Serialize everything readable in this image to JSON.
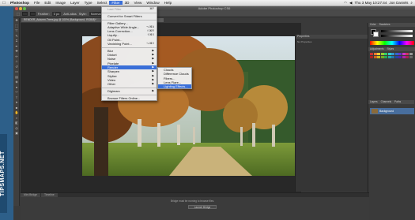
{
  "menubar": {
    "apple": "",
    "items": [
      "Photoshop",
      "File",
      "Edit",
      "Image",
      "Layer",
      "Type",
      "Select",
      "Filter",
      "3D",
      "View",
      "Window",
      "Help"
    ],
    "clock": "Thu 3 May  10:27:44",
    "user": "Jon Daniels"
  },
  "window": {
    "title": "Adobe Photoshop CS6",
    "doc_tab": "RENDER_Autumn-Trees.jpg @ 100% (Background, RGB/8)*"
  },
  "options_bar": {
    "feather_label": "Feather:",
    "feather_value": "0 px",
    "antialias_label": "Anti-alias",
    "style_label": "Style:",
    "style_value": "Normal"
  },
  "filter_menu": {
    "items": [
      {
        "label": "Last Filter",
        "shortcut": "⌘F",
        "disabled": true
      },
      {
        "sep": true
      },
      {
        "label": "Convert for Smart Filters"
      },
      {
        "sep": true
      },
      {
        "label": "Filter Gallery..."
      },
      {
        "label": "Adaptive Wide Angle...",
        "shortcut": "⌥⌘A"
      },
      {
        "label": "Lens Correction...",
        "shortcut": "⇧⌘R"
      },
      {
        "label": "Liquify...",
        "shortcut": "⇧⌘X"
      },
      {
        "label": "Oil Paint..."
      },
      {
        "label": "Vanishing Point...",
        "shortcut": "⌥⌘V"
      },
      {
        "sep": true
      },
      {
        "label": "Blur",
        "submenu": true
      },
      {
        "label": "Distort",
        "submenu": true
      },
      {
        "label": "Noise",
        "submenu": true
      },
      {
        "label": "Pixelate",
        "submenu": true
      },
      {
        "label": "Render",
        "submenu": true,
        "highlighted": true
      },
      {
        "label": "Sharpen",
        "submenu": true
      },
      {
        "label": "Stylize",
        "submenu": true
      },
      {
        "label": "Video",
        "submenu": true
      },
      {
        "label": "Other",
        "submenu": true
      },
      {
        "sep": true
      },
      {
        "label": "Digimarc",
        "submenu": true
      },
      {
        "sep": true
      },
      {
        "label": "Browse Filters Online..."
      }
    ]
  },
  "render_menu": {
    "items": [
      {
        "label": "Clouds"
      },
      {
        "label": "Difference Clouds"
      },
      {
        "label": "Fibers..."
      },
      {
        "label": "Lens Flare..."
      },
      {
        "label": "Lighting Effects...",
        "highlighted": true
      }
    ]
  },
  "mid_panel": {
    "title": "Properties",
    "subtitle": "No Properties"
  },
  "right_panels": {
    "color_tab": "Color",
    "swatches_tab": "Swatches",
    "adjust_tab": "Adjustments",
    "styles_tab": "Styles",
    "layers_tab": "Layers",
    "channels_tab": "Channels",
    "paths_tab": "Paths",
    "layer_name": "Background"
  },
  "bottom_panel": {
    "tabs": [
      "Mini Bridge",
      "Timeline"
    ],
    "message": "Bridge must be running to browse files.",
    "button": "Launch Bridge"
  },
  "watermark": "TIPSMAPS.NET",
  "colors": {
    "accent": "#3a6fd8",
    "desktop": "#2d5f89",
    "workspace": "#282828"
  }
}
